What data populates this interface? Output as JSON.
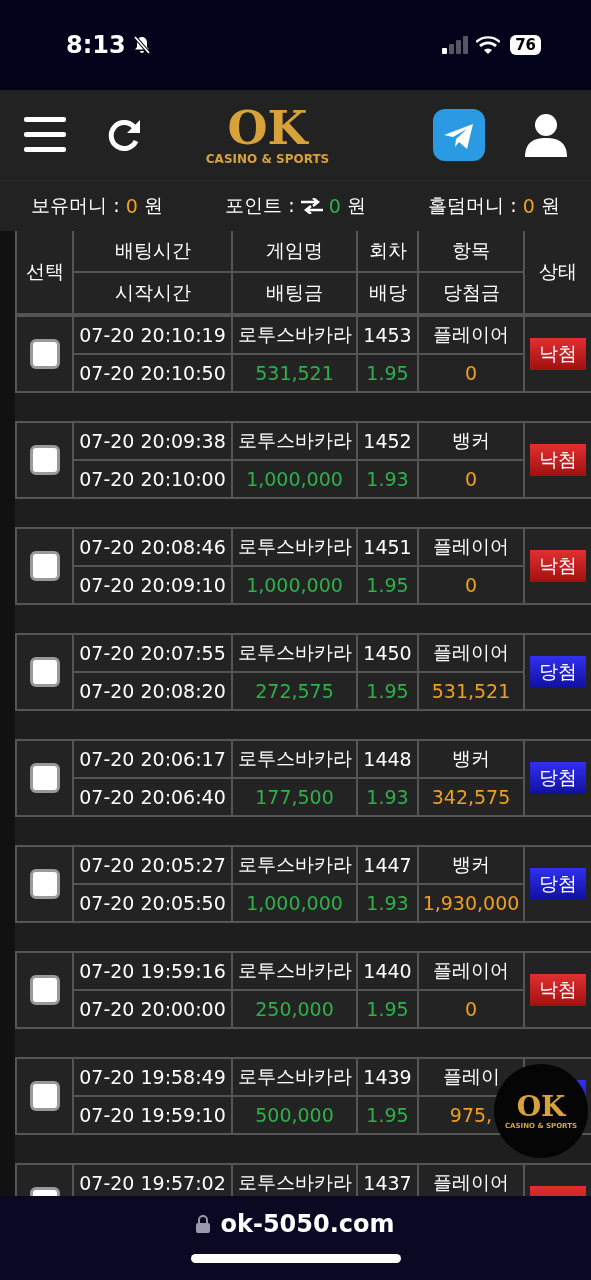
{
  "status_bar": {
    "time": "8:13",
    "battery": "76"
  },
  "header": {
    "logo": "OK",
    "logo_sub": "CASINO & SPORTS"
  },
  "balances": [
    {
      "label": "보유머니 :",
      "value": "0",
      "unit": "원",
      "kind": "plain"
    },
    {
      "label": "포인트 :",
      "value": "0",
      "unit": "원",
      "kind": "exchange"
    },
    {
      "label": "홀덤머니 :",
      "value": "0",
      "unit": "원",
      "kind": "plain"
    }
  ],
  "table": {
    "select": "선택",
    "status": "상태",
    "top": [
      "배팅시간",
      "게임명",
      "회차",
      "항목"
    ],
    "bottom": [
      "시작시간",
      "배팅금",
      "배당",
      "당첨금"
    ],
    "rows": [
      {
        "checked": false,
        "bet_time": "07-20 20:10:19",
        "game": "로투스바카라",
        "round": "1453",
        "item": "플레이어",
        "start_time": "07-20 20:10:50",
        "stake": "531,521",
        "odds": "1.95",
        "payout": "0",
        "status": {
          "kind": "lost",
          "label": "낙첨"
        }
      },
      {
        "checked": false,
        "bet_time": "07-20 20:09:38",
        "game": "로투스바카라",
        "round": "1452",
        "item": "뱅커",
        "start_time": "07-20 20:10:00",
        "stake": "1,000,000",
        "odds": "1.93",
        "payout": "0",
        "status": {
          "kind": "lost",
          "label": "낙첨"
        }
      },
      {
        "checked": false,
        "bet_time": "07-20 20:08:46",
        "game": "로투스바카라",
        "round": "1451",
        "item": "플레이어",
        "start_time": "07-20 20:09:10",
        "stake": "1,000,000",
        "odds": "1.95",
        "payout": "0",
        "status": {
          "kind": "lost",
          "label": "낙첨"
        }
      },
      {
        "checked": false,
        "bet_time": "07-20 20:07:55",
        "game": "로투스바카라",
        "round": "1450",
        "item": "플레이어",
        "start_time": "07-20 20:08:20",
        "stake": "272,575",
        "odds": "1.95",
        "payout": "531,521",
        "status": {
          "kind": "won",
          "label": "당첨"
        }
      },
      {
        "checked": false,
        "bet_time": "07-20 20:06:17",
        "game": "로투스바카라",
        "round": "1448",
        "item": "뱅커",
        "start_time": "07-20 20:06:40",
        "stake": "177,500",
        "odds": "1.93",
        "payout": "342,575",
        "status": {
          "kind": "won",
          "label": "당첨"
        }
      },
      {
        "checked": false,
        "bet_time": "07-20 20:05:27",
        "game": "로투스바카라",
        "round": "1447",
        "item": "뱅커",
        "start_time": "07-20 20:05:50",
        "stake": "1,000,000",
        "odds": "1.93",
        "payout": "1,930,000",
        "status": {
          "kind": "won",
          "label": "당첨"
        }
      },
      {
        "checked": false,
        "bet_time": "07-20 19:59:16",
        "game": "로투스바카라",
        "round": "1440",
        "item": "플레이어",
        "start_time": "07-20 20:00:00",
        "stake": "250,000",
        "odds": "1.95",
        "payout": "0",
        "status": {
          "kind": "lost",
          "label": "낙첨"
        }
      },
      {
        "checked": false,
        "bet_time": "07-20 19:58:49",
        "game": "로투스바카라",
        "round": "1439",
        "item": "플레이",
        "start_time": "07-20 19:59:10",
        "stake": "500,000",
        "odds": "1.95",
        "payout": "975,",
        "status": {
          "kind": "won"
        }
      },
      {
        "checked": false,
        "bet_time": "07-20 19:57:02",
        "game": "로투스바카라",
        "round": "1437",
        "item": "플레이어",
        "status": {
          "kind": "lost"
        }
      }
    ]
  },
  "floating_logo": {
    "logo": "OK",
    "logo_sub": "CASINO & SPORTS"
  },
  "browser_bar": {
    "url": "ok-5050.com"
  }
}
